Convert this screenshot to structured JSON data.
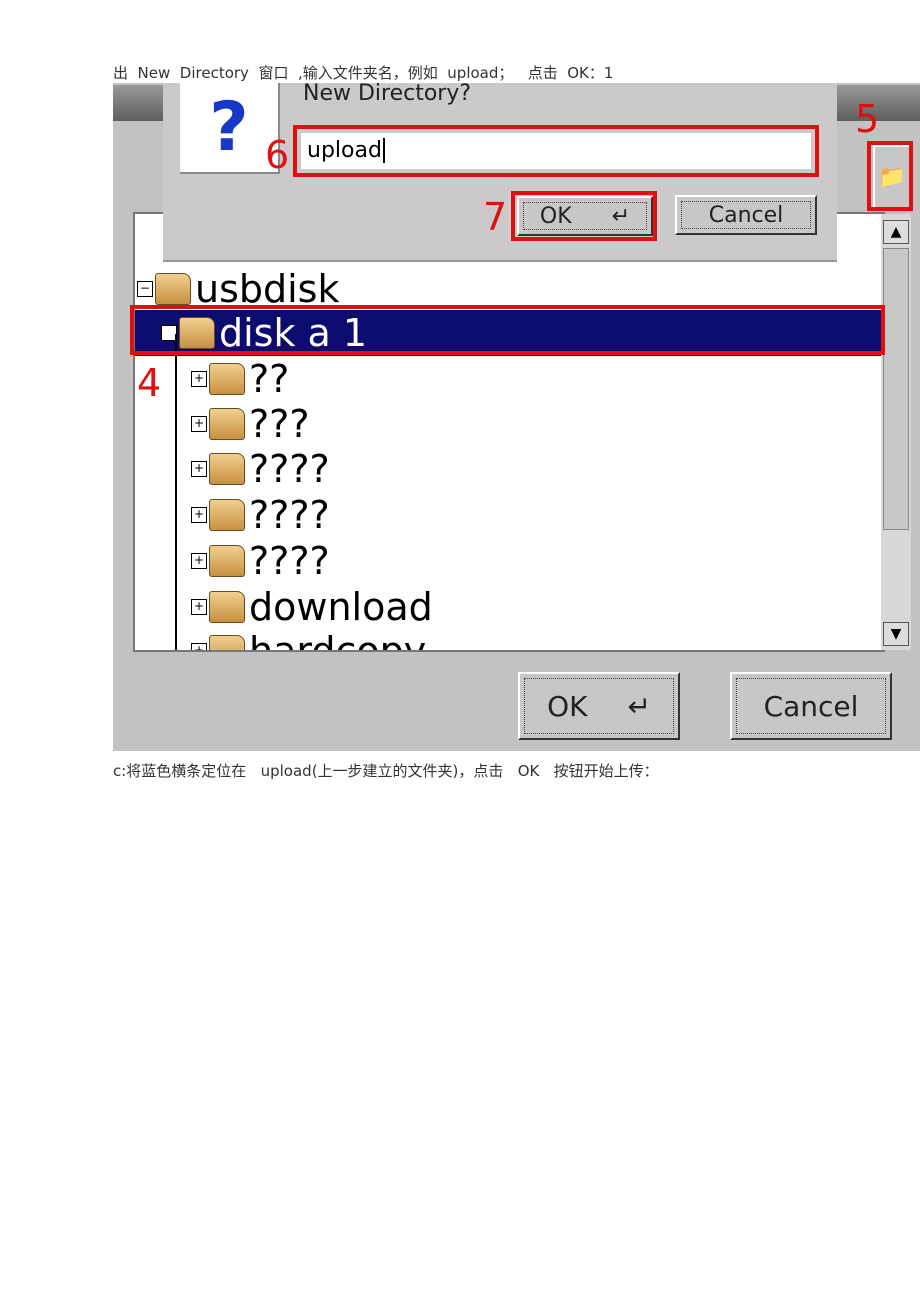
{
  "captions": {
    "top": "出  New  Directory  窗口  ,输入文件夹名，例如  upload；   点击  OK：1",
    "bottom": "c:将蓝色横条定位在   upload(上一步建立的文件夹)，点击   OK   按钮开始上传："
  },
  "dialog": {
    "title": "New Directory?",
    "icon": "question-icon",
    "input_value": "upload",
    "ok_label": "OK",
    "cancel_label": "Cancel"
  },
  "annotations": [
    "4",
    "5",
    "6",
    "7"
  ],
  "tree": {
    "items": [
      {
        "label": "usbdisk",
        "expander": "⊟"
      },
      {
        "label": "disk  a  1",
        "expander": "⊕",
        "selected": true
      },
      {
        "label": "??",
        "expander": "⊞"
      },
      {
        "label": "???",
        "expander": "⊞"
      },
      {
        "label": "????",
        "expander": "⊞"
      },
      {
        "label": "????",
        "expander": "⊞"
      },
      {
        "label": "????",
        "expander": "⊞"
      },
      {
        "label": "download",
        "expander": "⊞"
      },
      {
        "label": "hardcopy",
        "expander": "⊞"
      }
    ]
  },
  "footer": {
    "ok_label": "OK",
    "cancel_label": "Cancel"
  },
  "colors": {
    "selection": "#0b0b70",
    "annotation": "#e01010",
    "question": "#1538c8"
  }
}
